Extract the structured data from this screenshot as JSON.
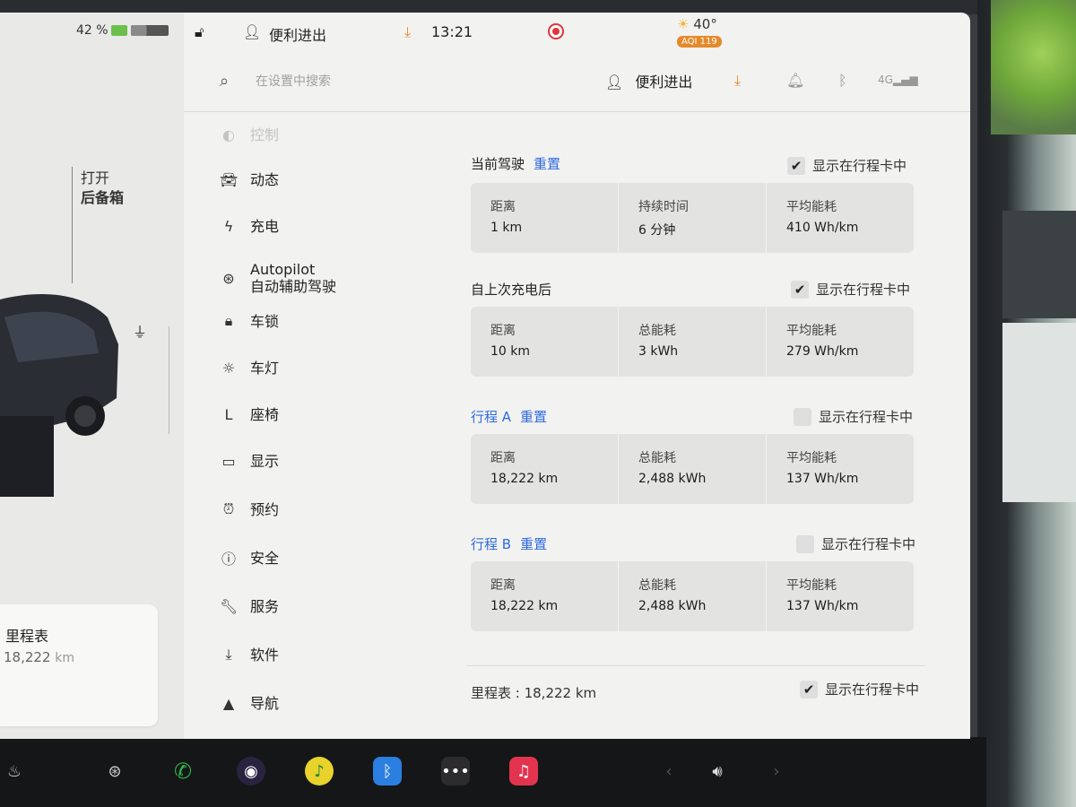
{
  "status_bar": {
    "battery_percent": "42 %",
    "battery_level": 0.42,
    "user": "便利进出",
    "time": "13:21",
    "temperature": "40°",
    "aqi": "AQI 119"
  },
  "car_panel": {
    "trunk_line1": "打开",
    "trunk_line2": "后备箱",
    "odometer_title": "里程表",
    "odometer_value": "18,222",
    "odometer_unit": "km"
  },
  "header": {
    "search_placeholder": "在设置中搜索",
    "user": "便利进出"
  },
  "nav": {
    "items": [
      {
        "label": "控制",
        "icon": "toggle-icon"
      },
      {
        "label": "动态",
        "icon": "car-icon"
      },
      {
        "label": "充电",
        "icon": "bolt-icon"
      },
      {
        "label": "Autopilot",
        "label2": "自动辅助驾驶",
        "icon": "steering-wheel-icon"
      },
      {
        "label": "车锁",
        "icon": "lock-icon"
      },
      {
        "label": "车灯",
        "icon": "light-icon"
      },
      {
        "label": "座椅",
        "icon": "seat-icon"
      },
      {
        "label": "显示",
        "icon": "display-icon"
      },
      {
        "label": "预约",
        "icon": "alarm-icon"
      },
      {
        "label": "安全",
        "icon": "safety-icon"
      },
      {
        "label": "服务",
        "icon": "wrench-icon"
      },
      {
        "label": "软件",
        "icon": "download-icon"
      },
      {
        "label": "导航",
        "icon": "navigation-icon"
      }
    ]
  },
  "trips": {
    "current": {
      "title": "当前驾驶",
      "reset": "重置",
      "show_label": "显示在行程卡中",
      "checked": true,
      "cells": [
        {
          "label": "距离",
          "value": "1 km"
        },
        {
          "label": "持续时间",
          "value": "6 分钟"
        },
        {
          "label": "平均能耗",
          "value": "410 Wh/km"
        }
      ]
    },
    "since_charge": {
      "title": "自上次充电后",
      "show_label": "显示在行程卡中",
      "checked": true,
      "cells": [
        {
          "label": "距离",
          "value": "10 km"
        },
        {
          "label": "总能耗",
          "value": "3 kWh"
        },
        {
          "label": "平均能耗",
          "value": "279 Wh/km"
        }
      ]
    },
    "trip_a": {
      "title": "行程 A",
      "reset": "重置",
      "show_label": "显示在行程卡中",
      "checked": false,
      "cells": [
        {
          "label": "距离",
          "value": "18,222 km"
        },
        {
          "label": "总能耗",
          "value": "2,488 kWh"
        },
        {
          "label": "平均能耗",
          "value": "137 Wh/km"
        }
      ]
    },
    "trip_b": {
      "title": "行程 B",
      "reset": "重置",
      "show_label": "显示在行程卡中",
      "checked": false,
      "cells": [
        {
          "label": "距离",
          "value": "18,222 km"
        },
        {
          "label": "总能耗",
          "value": "2,488 kWh"
        },
        {
          "label": "平均能耗",
          "value": "137 Wh/km"
        }
      ]
    },
    "odometer": {
      "text": "里程表 : 18,222 km",
      "show_label": "显示在行程卡中",
      "checked": true
    }
  },
  "colors": {
    "accent_blue": "#2f6ae0",
    "record_red": "#e0353b",
    "aqi_orange": "#e58a2b"
  }
}
